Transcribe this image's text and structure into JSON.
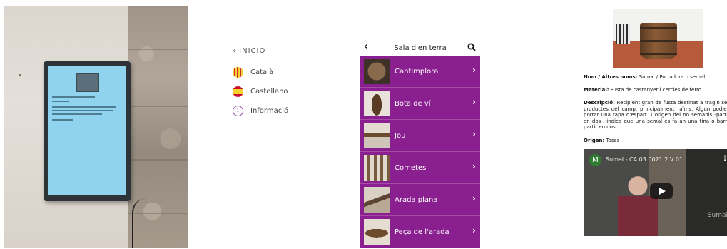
{
  "menu": {
    "back_label": "‹ INICIO",
    "items": [
      {
        "label": "Català",
        "icon": "catalan-flag-icon"
      },
      {
        "label": "Castellano",
        "icon": "spanish-flag-icon"
      },
      {
        "label": "Informació",
        "icon": "info-icon"
      }
    ]
  },
  "app": {
    "back_icon": "‹",
    "title": "Sala d'en terra",
    "theme_color": "#8a1f8f",
    "items": [
      {
        "label": "Cantimplora"
      },
      {
        "label": "Bota de ví"
      },
      {
        "label": "Jou"
      },
      {
        "label": "Cometes"
      },
      {
        "label": "Arada plana"
      },
      {
        "label": "Peça de l'arada"
      }
    ],
    "chevron": "›"
  },
  "detail": {
    "name_label": "Nom / Altres noms:",
    "name_value": " Sumal / Portadora o semal",
    "material_label": "Material:",
    "material_value": " Fusta de castanyer i cercles de ferro",
    "desc_label": "Descripció:",
    "desc_value": " Recipient gran de fusta destinat a tragin ses productes del camp, principalment raïms. Algun podien portar una tapa d'espart. L'origen del no semanis -partit en dos-, indica que una semal es fa an una tina o barril partit en dos.",
    "origin_label": "Origen:",
    "origin_value": " Tossa",
    "video": {
      "channel_initial": "M",
      "title": "Sumal - CA 03 0021 2 V 01",
      "watermark": "Sumal"
    }
  }
}
